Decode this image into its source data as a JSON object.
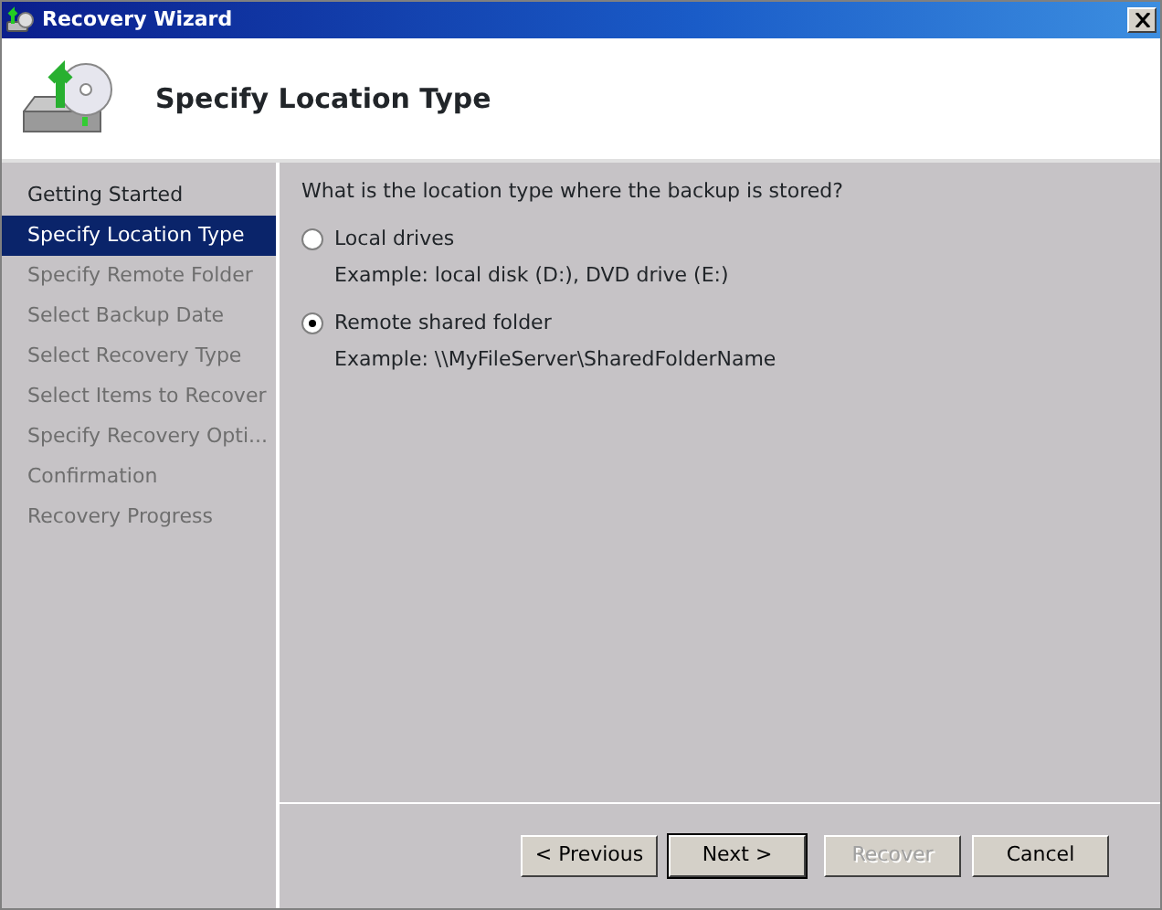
{
  "window": {
    "title": "Recovery Wizard"
  },
  "header": {
    "title": "Specify Location Type"
  },
  "steps": [
    {
      "label": "Getting Started",
      "selected": false,
      "disabled": false
    },
    {
      "label": "Specify Location Type",
      "selected": true,
      "disabled": false
    },
    {
      "label": "Specify Remote Folder",
      "selected": false,
      "disabled": true
    },
    {
      "label": "Select Backup Date",
      "selected": false,
      "disabled": true
    },
    {
      "label": "Select Recovery Type",
      "selected": false,
      "disabled": true
    },
    {
      "label": "Select Items to Recover",
      "selected": false,
      "disabled": true
    },
    {
      "label": "Specify Recovery Opti...",
      "selected": false,
      "disabled": true
    },
    {
      "label": "Confirmation",
      "selected": false,
      "disabled": true
    },
    {
      "label": "Recovery Progress",
      "selected": false,
      "disabled": true
    }
  ],
  "question": "What is the location type where the backup is stored?",
  "options": [
    {
      "label": "Local drives",
      "example": "Example: local disk (D:), DVD drive (E:)",
      "selected": false
    },
    {
      "label": "Remote shared folder",
      "example": "Example: \\\\MyFileServer\\SharedFolderName",
      "selected": true
    }
  ],
  "buttons": [
    {
      "label": "< Previous",
      "default": false,
      "disabled": false
    },
    {
      "label": "Next >",
      "default": true,
      "disabled": false
    },
    {
      "label": "Recover",
      "default": false,
      "disabled": true
    },
    {
      "label": "Cancel",
      "default": false,
      "disabled": false
    }
  ]
}
